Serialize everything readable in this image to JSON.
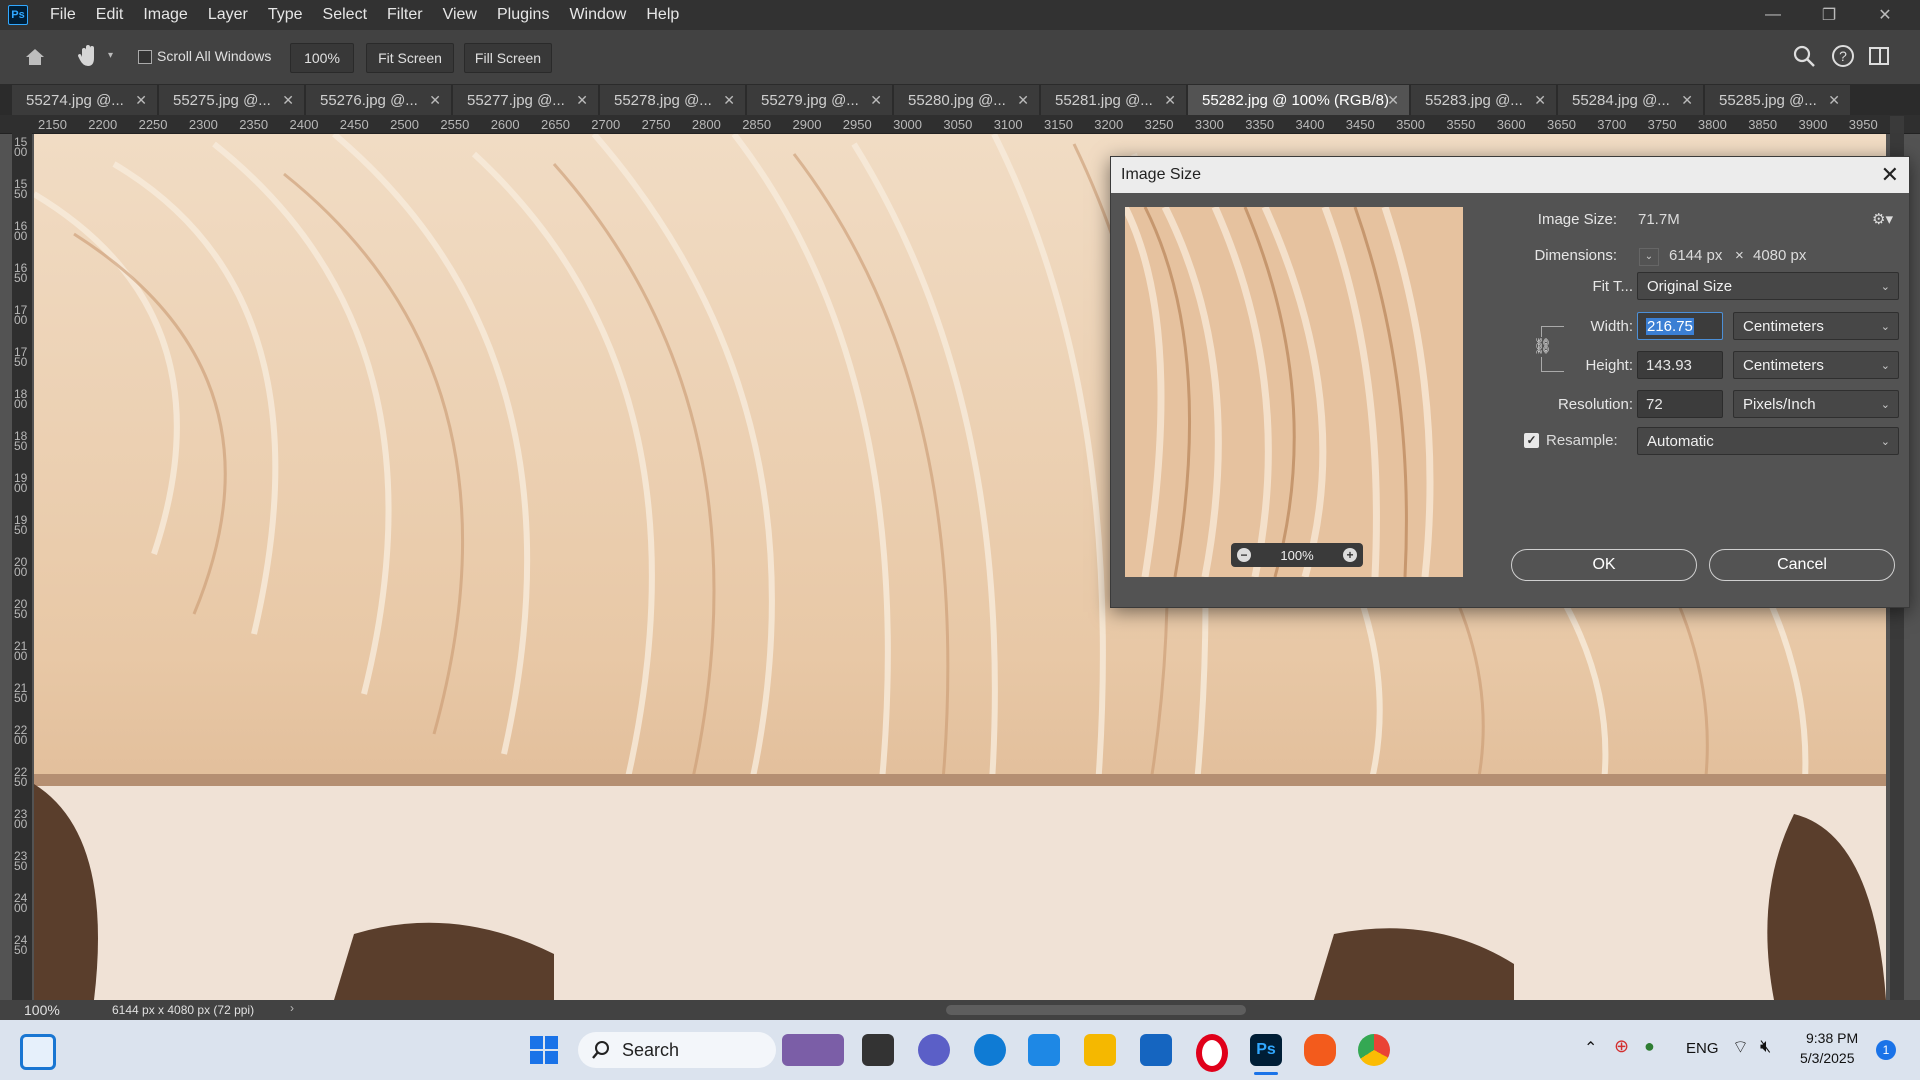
{
  "menubar": {
    "items": [
      "File",
      "Edit",
      "Image",
      "Layer",
      "Type",
      "Select",
      "Filter",
      "View",
      "Plugins",
      "Window",
      "Help"
    ]
  },
  "options": {
    "scroll_all": "Scroll All Windows",
    "zoom": "100%",
    "fit_screen": "Fit Screen",
    "fill_screen": "Fill Screen"
  },
  "tabs": [
    {
      "label": "55274.jpg @..."
    },
    {
      "label": "55275.jpg @..."
    },
    {
      "label": "55276.jpg @..."
    },
    {
      "label": "55277.jpg @..."
    },
    {
      "label": "55278.jpg @..."
    },
    {
      "label": "55279.jpg @..."
    },
    {
      "label": "55280.jpg @..."
    },
    {
      "label": "55281.jpg @..."
    },
    {
      "label": "55282.jpg @ 100% (RGB/8)"
    },
    {
      "label": "55283.jpg @..."
    },
    {
      "label": "55284.jpg @..."
    },
    {
      "label": "55285.jpg @..."
    }
  ],
  "ruler": {
    "top": [
      "2150",
      "2200",
      "2250",
      "2300",
      "2350",
      "2400",
      "2450",
      "2500",
      "2550",
      "2600",
      "2650",
      "2700",
      "2750",
      "2800",
      "2850",
      "2900",
      "2950",
      "3000",
      "3050",
      "3100",
      "3150",
      "3200",
      "3250",
      "3300",
      "3350",
      "3400",
      "3450",
      "3500",
      "3550",
      "3600",
      "3650",
      "3700",
      "3750",
      "3800",
      "3850",
      "3900",
      "3950"
    ],
    "left": [
      "1500",
      "1550",
      "1600",
      "1650",
      "1700",
      "1750",
      "1800",
      "1850",
      "1900",
      "1950",
      "2000",
      "2050",
      "2100",
      "2150",
      "2200",
      "2250",
      "2300",
      "2350",
      "2400",
      "2450"
    ]
  },
  "status": {
    "zoom": "100%",
    "doc_info": "6144 px x 4080 px (72 ppi)"
  },
  "dialog": {
    "title": "Image Size",
    "preview_zoom": "100%",
    "image_size_label": "Image Size:",
    "image_size_value": "71.7M",
    "dimensions_label": "Dimensions:",
    "dim_w": "6144 px",
    "dim_x": "×",
    "dim_h": "4080 px",
    "fit_label": "Fit T...",
    "fit_value": "Original Size",
    "width_label": "Width:",
    "width_value": "216.75",
    "width_unit": "Centimeters",
    "height_label": "Height:",
    "height_value": "143.93",
    "height_unit": "Centimeters",
    "resolution_label": "Resolution:",
    "resolution_value": "72",
    "resolution_unit": "Pixels/Inch",
    "resample_label": "Resample:",
    "resample_value": "Automatic",
    "ok": "OK",
    "cancel": "Cancel"
  },
  "taskbar": {
    "search": "Search",
    "lang": "ENG",
    "time": "9:38 PM",
    "date": "5/3/2025",
    "notif_count": "1"
  },
  "colors": {
    "accent": "#31a8ff",
    "dialog_bg": "#535353",
    "canvas_fur": "#e9cfb3"
  }
}
